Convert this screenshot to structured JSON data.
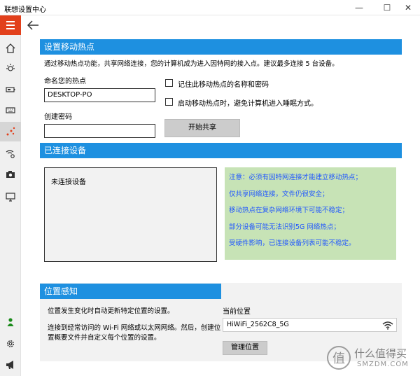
{
  "window": {
    "title": "联想设置中心",
    "minimize": "—",
    "maximize": "☐",
    "close": "✕"
  },
  "sidebar": {
    "items": [
      {
        "icon": "home-icon"
      },
      {
        "icon": "brightness-icon"
      },
      {
        "icon": "battery-icon"
      },
      {
        "icon": "keyboard-icon"
      },
      {
        "icon": "hotspot-icon",
        "active": true
      },
      {
        "icon": "wireless-settings-icon"
      },
      {
        "icon": "camera-icon"
      },
      {
        "icon": "monitor-icon"
      }
    ],
    "bottom_items": [
      {
        "icon": "user-icon"
      },
      {
        "icon": "gear-icon"
      },
      {
        "icon": "megaphone-icon"
      }
    ]
  },
  "hotspot": {
    "header": "设置移动热点",
    "description": "通过移动热点功能，共享网络连接，您的计算机成为进入因特网的接入点。建议最多连接 5 台设备。",
    "name_label": "命名您的热点",
    "name_value": "DESKTOP-PO",
    "password_label": "创建密码",
    "password_value": "",
    "remember_label": "记住此移动热点的名称和密码",
    "nosleep_label": "启动移动热点时，避免计算机进入睡眠方式。",
    "start_button": "开始共享"
  },
  "devices": {
    "header": "已连接设备",
    "empty_text": "未连接设备",
    "notes": [
      "注意：必须有因特网连接才能建立移动热点；",
      "仅共享网络连接，文件仍很安全；",
      "移动热点在复杂网络环境下可能不稳定；",
      "部分设备可能无法识别5G 网络热点；",
      "受硬件影响，已连接设备列表可能不稳定。"
    ]
  },
  "location": {
    "header": "位置感知",
    "desc1": "位置发生变化时自动更新特定位置的设置。",
    "desc2a": "连接到经常访问的 Wi-Fi 网络或以太网网络。然后，创建位",
    "desc2b": "置概要文件并自定义每个位置的设置。",
    "current_label": "当前位置",
    "current_value": "HiWiFi_2562C8_5G",
    "manage_button": "管理位置"
  },
  "watermark": {
    "brand": "什么值得买",
    "domain": "SMZDM.COM",
    "seal": "值"
  },
  "colors": {
    "accent": "#1e90e0",
    "hamburger": "#e2401c",
    "notes_bg": "#c7e3b6",
    "notes_text": "#1f56ff"
  }
}
